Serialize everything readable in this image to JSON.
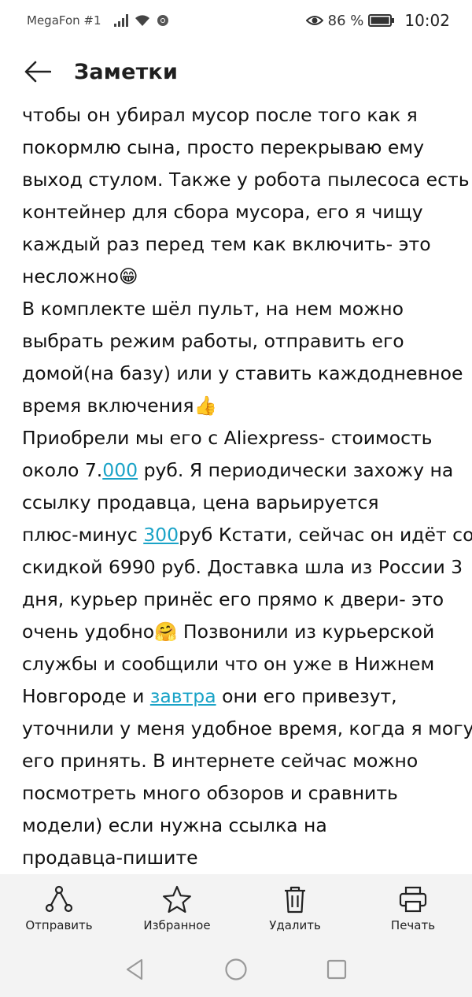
{
  "status_bar": {
    "carrier": "MegaFon #1",
    "battery_percent": "86 %",
    "time": "10:02"
  },
  "app_bar": {
    "title": "Заметки"
  },
  "note": {
    "lines": [
      [
        {
          "t": "чтобы он убирал мусор после того как я"
        }
      ],
      [
        {
          "t": "покормлю сына, просто перекрываю ему"
        }
      ],
      [
        {
          "t": "выход стулом. Также у робота пылесоса есть"
        }
      ],
      [
        {
          "t": "контейнер для сбора мусора, его я чищу"
        }
      ],
      [
        {
          "t": "каждый раз перед тем как включить- это"
        }
      ],
      [
        {
          "t": "несложно😁"
        }
      ],
      [
        {
          "t": "В комплекте шёл пульт, на нем можно"
        }
      ],
      [
        {
          "t": "выбрать режим работы, отправить его"
        }
      ],
      [
        {
          "t": "домой(на базу) или у ставить каждодневное"
        }
      ],
      [
        {
          "t": "время включения👍"
        }
      ],
      [
        {
          "t": "Приобрели мы его с Aliexpress- стоимость"
        }
      ],
      [
        {
          "t": "около 7."
        },
        {
          "t": "000",
          "link": true
        },
        {
          "t": " руб. Я периодически захожу на"
        }
      ],
      [
        {
          "t": "ссылку продавца, цена варьируется"
        }
      ],
      [
        {
          "t": "плюс-минус "
        },
        {
          "t": "300",
          "link": true
        },
        {
          "t": "руб Кстати, сейчас он идёт со"
        }
      ],
      [
        {
          "t": "скидкой 6990 руб. Доставка шла из России 3"
        }
      ],
      [
        {
          "t": "дня, курьер принёс его прямо к двери- это"
        }
      ],
      [
        {
          "t": "очень  удобно🤗  Позвонили из курьерской"
        }
      ],
      [
        {
          "t": "службы и сообщили что он уже в Нижнем"
        }
      ],
      [
        {
          "t": "Новгороде и  "
        },
        {
          "t": "завтра",
          "link": true
        },
        {
          "t": " они его привезут,"
        }
      ],
      [
        {
          "t": "уточнили у меня удобное время, когда я могу"
        }
      ],
      [
        {
          "t": "его принять.    В интернете сейчас можно"
        }
      ],
      [
        {
          "t": "посмотреть много обзоров и сравнить"
        }
      ],
      [
        {
          "t": "модели) если нужна ссылка на"
        }
      ],
      [
        {
          "t": "продавца-пишите"
        }
      ]
    ]
  },
  "bottom_actions": {
    "send": "Отправить",
    "favorite": "Избранное",
    "delete": "Удалить",
    "print": "Печать"
  }
}
